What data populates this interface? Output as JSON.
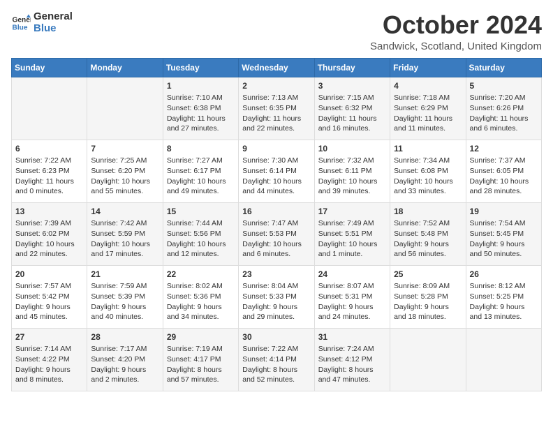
{
  "logo": {
    "general": "General",
    "blue": "Blue"
  },
  "title": "October 2024",
  "subtitle": "Sandwick, Scotland, United Kingdom",
  "headers": [
    "Sunday",
    "Monday",
    "Tuesday",
    "Wednesday",
    "Thursday",
    "Friday",
    "Saturday"
  ],
  "weeks": [
    [
      {
        "day": "",
        "lines": []
      },
      {
        "day": "",
        "lines": []
      },
      {
        "day": "1",
        "lines": [
          "Sunrise: 7:10 AM",
          "Sunset: 6:38 PM",
          "Daylight: 11 hours",
          "and 27 minutes."
        ]
      },
      {
        "day": "2",
        "lines": [
          "Sunrise: 7:13 AM",
          "Sunset: 6:35 PM",
          "Daylight: 11 hours",
          "and 22 minutes."
        ]
      },
      {
        "day": "3",
        "lines": [
          "Sunrise: 7:15 AM",
          "Sunset: 6:32 PM",
          "Daylight: 11 hours",
          "and 16 minutes."
        ]
      },
      {
        "day": "4",
        "lines": [
          "Sunrise: 7:18 AM",
          "Sunset: 6:29 PM",
          "Daylight: 11 hours",
          "and 11 minutes."
        ]
      },
      {
        "day": "5",
        "lines": [
          "Sunrise: 7:20 AM",
          "Sunset: 6:26 PM",
          "Daylight: 11 hours",
          "and 6 minutes."
        ]
      }
    ],
    [
      {
        "day": "6",
        "lines": [
          "Sunrise: 7:22 AM",
          "Sunset: 6:23 PM",
          "Daylight: 11 hours",
          "and 0 minutes."
        ]
      },
      {
        "day": "7",
        "lines": [
          "Sunrise: 7:25 AM",
          "Sunset: 6:20 PM",
          "Daylight: 10 hours",
          "and 55 minutes."
        ]
      },
      {
        "day": "8",
        "lines": [
          "Sunrise: 7:27 AM",
          "Sunset: 6:17 PM",
          "Daylight: 10 hours",
          "and 49 minutes."
        ]
      },
      {
        "day": "9",
        "lines": [
          "Sunrise: 7:30 AM",
          "Sunset: 6:14 PM",
          "Daylight: 10 hours",
          "and 44 minutes."
        ]
      },
      {
        "day": "10",
        "lines": [
          "Sunrise: 7:32 AM",
          "Sunset: 6:11 PM",
          "Daylight: 10 hours",
          "and 39 minutes."
        ]
      },
      {
        "day": "11",
        "lines": [
          "Sunrise: 7:34 AM",
          "Sunset: 6:08 PM",
          "Daylight: 10 hours",
          "and 33 minutes."
        ]
      },
      {
        "day": "12",
        "lines": [
          "Sunrise: 7:37 AM",
          "Sunset: 6:05 PM",
          "Daylight: 10 hours",
          "and 28 minutes."
        ]
      }
    ],
    [
      {
        "day": "13",
        "lines": [
          "Sunrise: 7:39 AM",
          "Sunset: 6:02 PM",
          "Daylight: 10 hours",
          "and 22 minutes."
        ]
      },
      {
        "day": "14",
        "lines": [
          "Sunrise: 7:42 AM",
          "Sunset: 5:59 PM",
          "Daylight: 10 hours",
          "and 17 minutes."
        ]
      },
      {
        "day": "15",
        "lines": [
          "Sunrise: 7:44 AM",
          "Sunset: 5:56 PM",
          "Daylight: 10 hours",
          "and 12 minutes."
        ]
      },
      {
        "day": "16",
        "lines": [
          "Sunrise: 7:47 AM",
          "Sunset: 5:53 PM",
          "Daylight: 10 hours",
          "and 6 minutes."
        ]
      },
      {
        "day": "17",
        "lines": [
          "Sunrise: 7:49 AM",
          "Sunset: 5:51 PM",
          "Daylight: 10 hours",
          "and 1 minute."
        ]
      },
      {
        "day": "18",
        "lines": [
          "Sunrise: 7:52 AM",
          "Sunset: 5:48 PM",
          "Daylight: 9 hours",
          "and 56 minutes."
        ]
      },
      {
        "day": "19",
        "lines": [
          "Sunrise: 7:54 AM",
          "Sunset: 5:45 PM",
          "Daylight: 9 hours",
          "and 50 minutes."
        ]
      }
    ],
    [
      {
        "day": "20",
        "lines": [
          "Sunrise: 7:57 AM",
          "Sunset: 5:42 PM",
          "Daylight: 9 hours",
          "and 45 minutes."
        ]
      },
      {
        "day": "21",
        "lines": [
          "Sunrise: 7:59 AM",
          "Sunset: 5:39 PM",
          "Daylight: 9 hours",
          "and 40 minutes."
        ]
      },
      {
        "day": "22",
        "lines": [
          "Sunrise: 8:02 AM",
          "Sunset: 5:36 PM",
          "Daylight: 9 hours",
          "and 34 minutes."
        ]
      },
      {
        "day": "23",
        "lines": [
          "Sunrise: 8:04 AM",
          "Sunset: 5:33 PM",
          "Daylight: 9 hours",
          "and 29 minutes."
        ]
      },
      {
        "day": "24",
        "lines": [
          "Sunrise: 8:07 AM",
          "Sunset: 5:31 PM",
          "Daylight: 9 hours",
          "and 24 minutes."
        ]
      },
      {
        "day": "25",
        "lines": [
          "Sunrise: 8:09 AM",
          "Sunset: 5:28 PM",
          "Daylight: 9 hours",
          "and 18 minutes."
        ]
      },
      {
        "day": "26",
        "lines": [
          "Sunrise: 8:12 AM",
          "Sunset: 5:25 PM",
          "Daylight: 9 hours",
          "and 13 minutes."
        ]
      }
    ],
    [
      {
        "day": "27",
        "lines": [
          "Sunrise: 7:14 AM",
          "Sunset: 4:22 PM",
          "Daylight: 9 hours",
          "and 8 minutes."
        ]
      },
      {
        "day": "28",
        "lines": [
          "Sunrise: 7:17 AM",
          "Sunset: 4:20 PM",
          "Daylight: 9 hours",
          "and 2 minutes."
        ]
      },
      {
        "day": "29",
        "lines": [
          "Sunrise: 7:19 AM",
          "Sunset: 4:17 PM",
          "Daylight: 8 hours",
          "and 57 minutes."
        ]
      },
      {
        "day": "30",
        "lines": [
          "Sunrise: 7:22 AM",
          "Sunset: 4:14 PM",
          "Daylight: 8 hours",
          "and 52 minutes."
        ]
      },
      {
        "day": "31",
        "lines": [
          "Sunrise: 7:24 AM",
          "Sunset: 4:12 PM",
          "Daylight: 8 hours",
          "and 47 minutes."
        ]
      },
      {
        "day": "",
        "lines": []
      },
      {
        "day": "",
        "lines": []
      }
    ]
  ]
}
